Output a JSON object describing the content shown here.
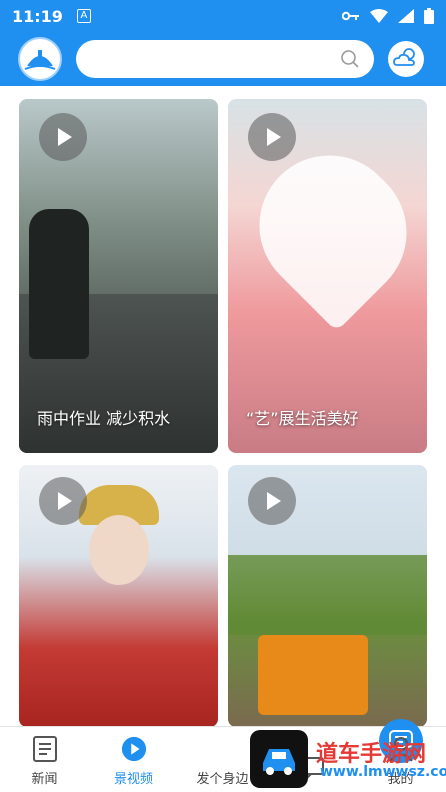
{
  "status_bar": {
    "time": "11:19",
    "a_badge": "A"
  },
  "header": {
    "search_placeholder": ""
  },
  "cards": [
    {
      "caption": "雨中作业 减少积水"
    },
    {
      "caption": "“艺”展生活美好"
    },
    {
      "caption": ""
    },
    {
      "caption": ""
    }
  ],
  "bottom_nav": {
    "items": [
      {
        "label": "新闻"
      },
      {
        "label": "景视频"
      },
      {
        "label": "发个身边"
      },
      {
        "label": ""
      },
      {
        "label": "我的"
      }
    ],
    "accent": "#1f8ff0"
  },
  "watermark": {
    "text": "道车手游网",
    "url": "www.lmwwsz.com"
  }
}
